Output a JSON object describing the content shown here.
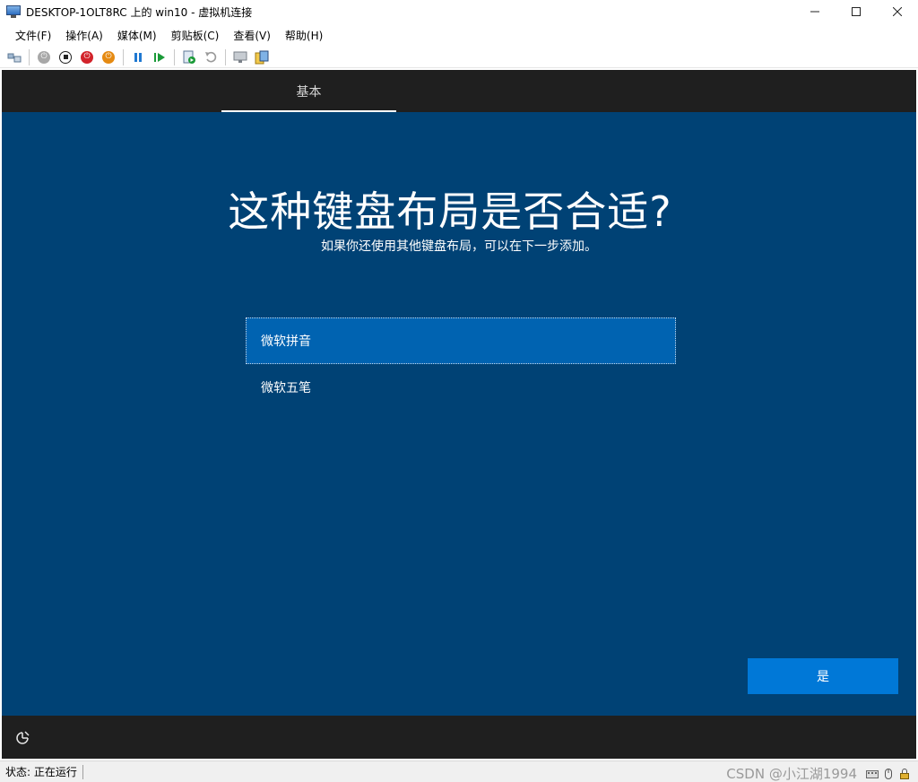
{
  "window": {
    "title": "DESKTOP-1OLT8RC 上的 win10 - 虚拟机连接",
    "controls": {
      "minimize": "—",
      "maximize": "☐",
      "close": "✕"
    }
  },
  "menubar": {
    "items": [
      "文件(F)",
      "操作(A)",
      "媒体(M)",
      "剪贴板(C)",
      "查看(V)",
      "帮助(H)"
    ]
  },
  "toolbar": {
    "icons": [
      "ctrl-alt-del-icon",
      "start-icon",
      "turn-off-icon",
      "shutdown-icon",
      "save-icon",
      "pause-icon",
      "resume-icon",
      "checkpoint-icon",
      "revert-icon",
      "enhanced-session-icon",
      "share-icon"
    ]
  },
  "vm": {
    "tab_label": "基本",
    "heading": "这种键盘布局是否合适?",
    "subheading": "如果你还使用其他键盘布局，可以在下一步添加。",
    "layouts": [
      {
        "label": "微软拼音",
        "selected": true
      },
      {
        "label": "微软五笔",
        "selected": false
      }
    ],
    "yes_label": "是",
    "colors": {
      "background": "#004275",
      "selected": "#0063b1",
      "button": "#0078d7",
      "bars": "#1f1f1f"
    }
  },
  "statusbar": {
    "status": "状态: 正在运行",
    "watermark": "CSDN @小江湖1994"
  }
}
